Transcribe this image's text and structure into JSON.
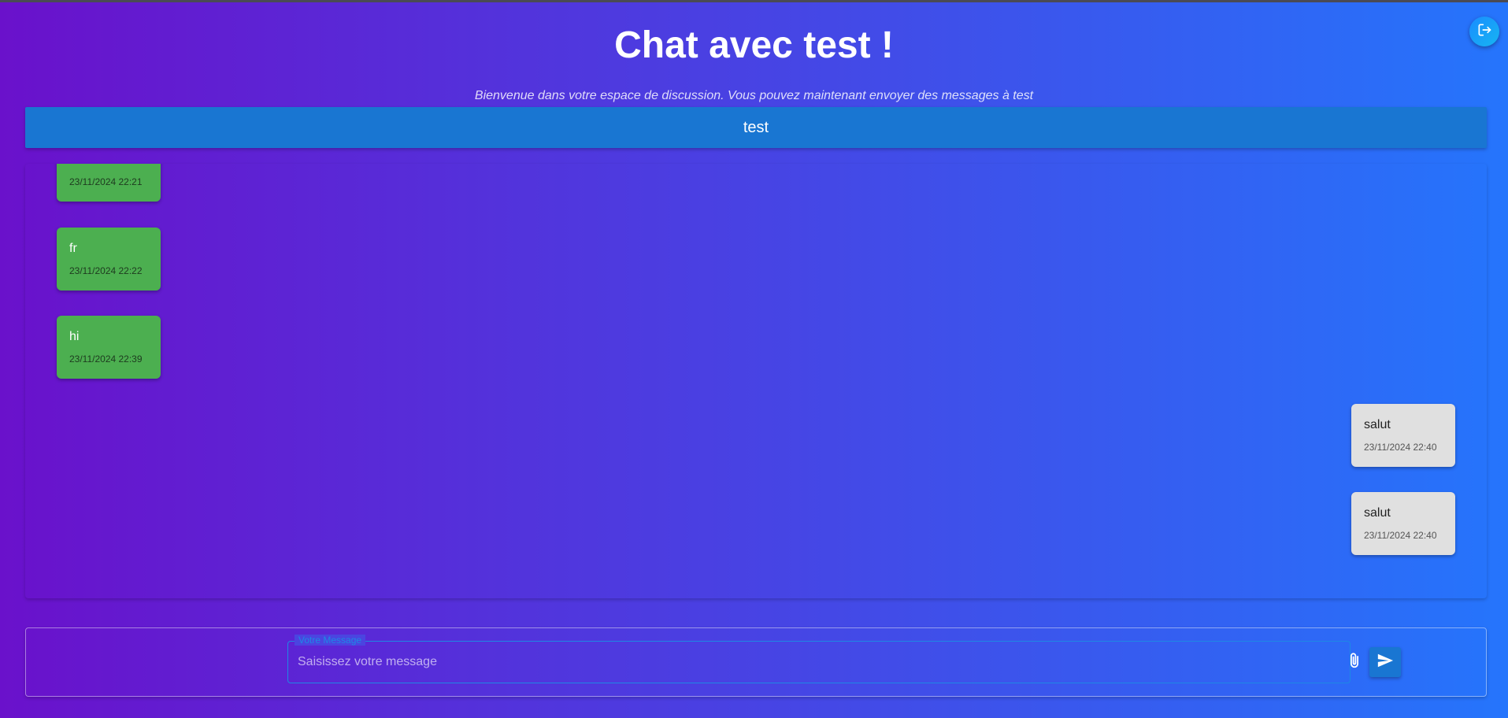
{
  "header": {
    "title": "Chat avec test !",
    "subtitle": "Bienvenue dans votre espace de discussion. Vous pouvez maintenant envoyer des messages à test",
    "logout_icon": "logout-icon"
  },
  "contact": {
    "name": "test"
  },
  "messages": [
    {
      "direction": "sent",
      "text": "..",
      "time": "23/11/2024 22:21"
    },
    {
      "direction": "sent",
      "text": "fr",
      "time": "23/11/2024 22:22"
    },
    {
      "direction": "sent",
      "text": "hi",
      "time": "23/11/2024 22:39"
    },
    {
      "direction": "received",
      "text": "salut",
      "time": "23/11/2024 22:40"
    },
    {
      "direction": "received",
      "text": "salut",
      "time": "23/11/2024 22:40"
    }
  ],
  "composer": {
    "label": "Votre Message",
    "placeholder": "Saisissez votre message",
    "value": "",
    "attach_icon": "paperclip-icon",
    "send_icon": "send-icon"
  },
  "colors": {
    "background_start": "#6a11cb",
    "background_end": "#2575fc",
    "header_bar": "#1976d2",
    "sent_bubble": "#4caf50",
    "received_bubble": "#e0e0e0",
    "accent": "#1e88e5"
  }
}
